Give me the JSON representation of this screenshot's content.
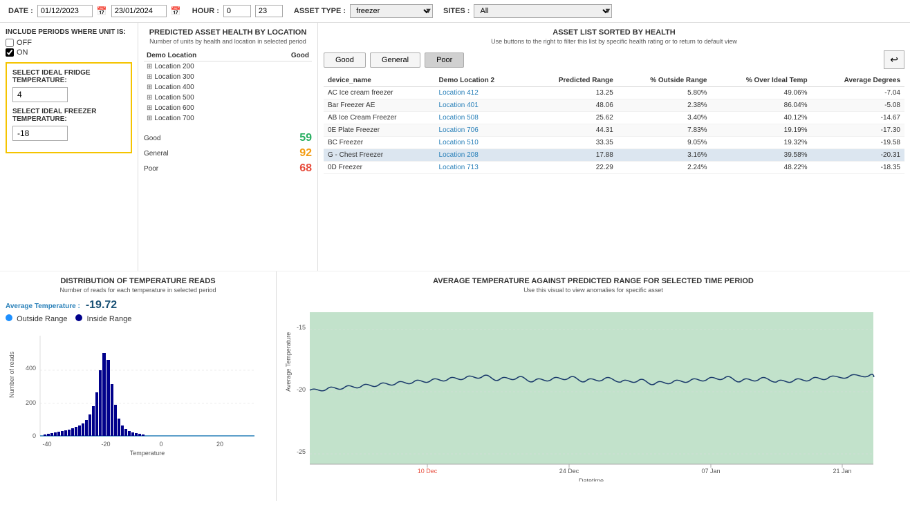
{
  "topbar": {
    "date_label": "DATE :",
    "date_from": "01/12/2023",
    "date_to": "23/01/2024",
    "hour_label": "HOUR :",
    "hour_from": "0",
    "hour_to": "23",
    "asset_type_label": "ASSET TYPE :",
    "asset_type_value": "freezer",
    "sites_label": "SITES :",
    "sites_value": "All"
  },
  "left_panel": {
    "include_label": "INCLUDE PERIODS WHERE UNIT IS:",
    "off_label": "OFF",
    "on_label": "ON",
    "fridge_label": "SELECT IDEAL FRIDGE TEMPERATURE:",
    "fridge_value": "4",
    "freezer_label": "SELECT IDEAL FREEZER TEMPERATURE:",
    "freezer_value": "-18"
  },
  "health_panel": {
    "title": "PREDICTED ASSET HEALTH BY LOCATION",
    "subtitle": "Number of units by health and location in selected period",
    "demo_location_col": "Demo Location",
    "good_col": "Good",
    "locations": [
      {
        "name": "Location 200"
      },
      {
        "name": "Location 300"
      },
      {
        "name": "Location 400"
      },
      {
        "name": "Location 500"
      },
      {
        "name": "Location 600"
      },
      {
        "name": "Location 700"
      }
    ],
    "good_label": "Good",
    "good_value": "59",
    "general_label": "General",
    "general_value": "92",
    "poor_label": "Poor",
    "poor_value": "68"
  },
  "asset_panel": {
    "title": "ASSET LIST SORTED BY HEALTH",
    "subtitle": "Use buttons to the right to filter this list by specific health rating or to return to default view",
    "btn_good": "Good",
    "btn_general": "General",
    "btn_poor": "Poor",
    "col_device": "device_name",
    "col_location": "Demo Location 2",
    "col_predicted": "Predicted Range",
    "col_outside": "% Outside Range",
    "col_ideal": "% Over Ideal Temp",
    "col_avg": "Average Degrees",
    "rows": [
      {
        "device": "AC Ice cream freezer",
        "location": "Location 412",
        "predicted": "13.25",
        "outside": "5.80%",
        "ideal": "49.06%",
        "avg": "-7.04"
      },
      {
        "device": "Bar Freezer AE",
        "location": "Location 401",
        "predicted": "48.06",
        "outside": "2.38%",
        "ideal": "86.04%",
        "avg": "-5.08"
      },
      {
        "device": "AB Ice Cream Freezer",
        "location": "Location 508",
        "predicted": "25.62",
        "outside": "3.40%",
        "ideal": "40.12%",
        "avg": "-14.67"
      },
      {
        "device": "0E Plate Freezer",
        "location": "Location 706",
        "predicted": "44.31",
        "outside": "7.83%",
        "ideal": "19.19%",
        "avg": "-17.30"
      },
      {
        "device": "BC Freezer",
        "location": "Location 510",
        "predicted": "33.35",
        "outside": "9.05%",
        "ideal": "19.32%",
        "avg": "-19.58"
      },
      {
        "device": "G - Chest Freezer",
        "location": "Location 208",
        "predicted": "17.88",
        "outside": "3.16%",
        "ideal": "39.58%",
        "avg": "-20.31"
      },
      {
        "device": "0D Freezer",
        "location": "Location 713",
        "predicted": "22.29",
        "outside": "2.24%",
        "ideal": "48.22%",
        "avg": "-18.35"
      }
    ]
  },
  "dist_panel": {
    "title": "DISTRIBUTION OF TEMPERATURE READS",
    "subtitle": "Number of reads for each temperature in selected period",
    "avg_label": "Average Temperature :",
    "avg_value": "-19.72",
    "legend_outside": "Outside Range",
    "legend_inside": "Inside Range",
    "y_axis_label": "Number of reads",
    "x_axis_label": "Temperature",
    "x_ticks": [
      "-40",
      "-20",
      "0",
      "20"
    ],
    "y_ticks": [
      "0",
      "200",
      "400"
    ]
  },
  "avg_temp_panel": {
    "title": "AVERAGE TEMPERATURE AGAINST PREDICTED RANGE FOR SELECTED TIME PERIOD",
    "subtitle": "Use this visual to view anomalies for specific asset",
    "y_label": "Average Temperature",
    "x_label": "Datetime",
    "x_ticks": [
      "10 Dec",
      "24 Dec",
      "07 Jan",
      "21 Jan"
    ],
    "y_ticks": [
      "-15",
      "-20",
      "-25"
    ]
  },
  "colors": {
    "good": "#27ae60",
    "general": "#f39c12",
    "poor": "#e74c3c",
    "link": "#2980b9",
    "highlight_row": "#dce6f0",
    "chart_band": "#a8d5b5",
    "chart_line": "#1a3a6b"
  }
}
